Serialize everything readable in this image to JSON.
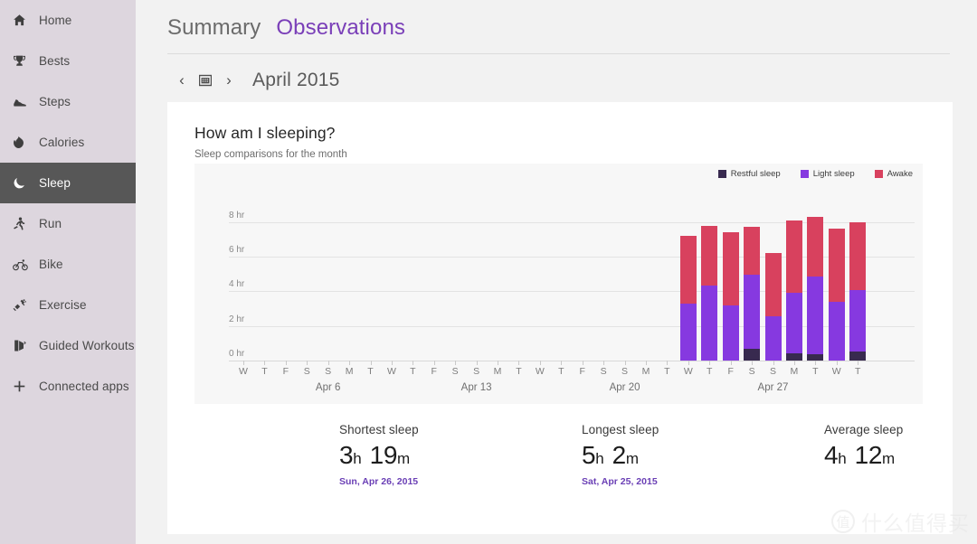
{
  "sidebar": {
    "items": [
      {
        "label": "Home",
        "icon": "home-icon",
        "active": false
      },
      {
        "label": "Bests",
        "icon": "trophy-icon",
        "active": false
      },
      {
        "label": "Steps",
        "icon": "shoe-icon",
        "active": false
      },
      {
        "label": "Calories",
        "icon": "flame-icon",
        "active": false
      },
      {
        "label": "Sleep",
        "icon": "moon-icon",
        "active": true
      },
      {
        "label": "Run",
        "icon": "runner-icon",
        "active": false
      },
      {
        "label": "Bike",
        "icon": "bicycle-icon",
        "active": false
      },
      {
        "label": "Exercise",
        "icon": "dumbbell-icon",
        "active": false
      },
      {
        "label": "Guided Workouts",
        "icon": "guided-workout-icon",
        "active": false
      },
      {
        "label": "Connected apps",
        "icon": "plus-icon",
        "active": false
      }
    ]
  },
  "header": {
    "tabs": [
      {
        "label": "Summary",
        "active": false
      },
      {
        "label": "Observations",
        "active": true
      }
    ],
    "prev_label": "‹",
    "next_label": "›",
    "calendar_icon": "calendar-icon",
    "month_label": "April 2015"
  },
  "card": {
    "title": "How am I sleeping?",
    "subtitle": "Sleep comparisons for the month"
  },
  "stats": [
    {
      "title": "Shortest sleep",
      "hours": "3",
      "h_unit": "h",
      "minutes": "19",
      "m_unit": "m",
      "date": "Sun, Apr 26, 2015"
    },
    {
      "title": "Longest sleep",
      "hours": "5",
      "h_unit": "h",
      "minutes": "2",
      "m_unit": "m",
      "date": "Sat, Apr 25, 2015"
    },
    {
      "title": "Average sleep",
      "hours": "4",
      "h_unit": "h",
      "minutes": "12",
      "m_unit": "m",
      "date": ""
    }
  ],
  "watermark": {
    "mark": "值",
    "text": "什么值得买"
  },
  "colors": {
    "restful": "#382a4f",
    "light": "#8639e0",
    "awake": "#d8415e",
    "accent": "#7a3fb8",
    "sidebar_bg": "#ddd6de",
    "sidebar_active_bg": "#575757",
    "card_bg": "#ffffff",
    "plot_bg": "#f7f7f7",
    "page_bg": "#f2f2f2"
  },
  "chart_data": {
    "type": "bar",
    "stacked": true,
    "title": "How am I sleeping?",
    "subtitle": "Sleep comparisons for the month",
    "xlabel": "",
    "ylabel": "",
    "ylim": [
      0,
      9
    ],
    "yticks": [
      0,
      2,
      4,
      6,
      8
    ],
    "ytick_labels": [
      "0 hr",
      "2 hr",
      "4 hr",
      "6 hr",
      "8 hr"
    ],
    "grid": true,
    "legend_position": "top-right",
    "legend": [
      {
        "name": "Restful sleep",
        "color": "#382a4f"
      },
      {
        "name": "Light sleep",
        "color": "#8639e0"
      },
      {
        "name": "Awake",
        "color": "#d8415e"
      }
    ],
    "categories": [
      "W",
      "T",
      "F",
      "S",
      "S",
      "M",
      "T",
      "W",
      "T",
      "F",
      "S",
      "S",
      "M",
      "T",
      "W",
      "T",
      "F",
      "S",
      "S",
      "M",
      "T",
      "W",
      "T",
      "F",
      "S",
      "S",
      "M",
      "T",
      "W",
      "T"
    ],
    "week_labels": [
      {
        "label": "Apr 6",
        "index": 4
      },
      {
        "label": "Apr 13",
        "index": 11
      },
      {
        "label": "Apr 20",
        "index": 18
      },
      {
        "label": "Apr 27",
        "index": 25
      }
    ],
    "series": [
      {
        "name": "Restful sleep",
        "color": "#382a4f",
        "values": [
          0,
          0,
          0,
          0,
          0,
          0,
          0,
          0,
          0,
          0,
          0,
          0,
          0,
          0,
          0,
          0,
          0,
          0,
          0,
          0,
          0,
          0,
          0,
          0,
          0.68,
          0,
          0.42,
          0.35,
          0,
          0.5
        ]
      },
      {
        "name": "Light sleep",
        "color": "#8639e0",
        "values": [
          0,
          0,
          0,
          0,
          0,
          0,
          0,
          0,
          0,
          0,
          0,
          0,
          0,
          0,
          0,
          0,
          0,
          0,
          0,
          0,
          0,
          3.3,
          4.35,
          3.2,
          4.3,
          2.56,
          3.5,
          4.52,
          3.4,
          3.6
        ]
      },
      {
        "name": "Awake",
        "color": "#d8415e",
        "values": [
          0,
          0,
          0,
          0,
          0,
          0,
          0,
          0,
          0,
          0,
          0,
          0,
          0,
          0,
          0,
          0,
          0,
          0,
          0,
          0,
          0,
          3.93,
          3.45,
          4.2,
          2.77,
          3.65,
          4.18,
          3.43,
          4.2,
          3.9
        ]
      }
    ],
    "totals": [
      0,
      0,
      0,
      0,
      0,
      0,
      0,
      0,
      0,
      0,
      0,
      0,
      0,
      0,
      0,
      0,
      0,
      0,
      0,
      0,
      0,
      7.23,
      7.8,
      7.4,
      7.75,
      6.21,
      8.1,
      8.3,
      7.6,
      8.0
    ]
  }
}
